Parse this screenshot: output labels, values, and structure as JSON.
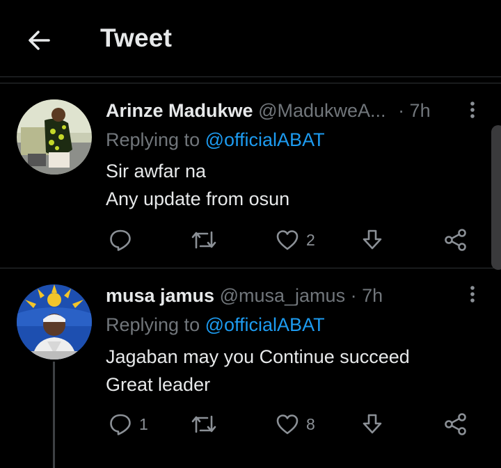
{
  "header": {
    "title": "Tweet"
  },
  "colors": {
    "background": "#000000",
    "link": "#1d9bf0",
    "secondary": "#71767b",
    "divider": "#2f3336"
  },
  "tweets": [
    {
      "name": "Arinze Madukwe",
      "handle": "@MadukweA...",
      "time": "· 7h",
      "replying_prefix": "Replying to ",
      "replying_handle": "@officialABAT",
      "lines": [
        "Sir awfar na",
        "Any update from osun"
      ],
      "reply_count": "",
      "retweet_count": "",
      "like_count": "2"
    },
    {
      "name": "musa jamus",
      "handle": "@musa_jamus",
      "time": "· 7h",
      "replying_prefix": "Replying to ",
      "replying_handle": "@officialABAT",
      "lines": [
        "Jagaban may you Continue succeed",
        "Great leader"
      ],
      "reply_count": "1",
      "retweet_count": "",
      "like_count": "8"
    }
  ],
  "icons": {
    "back": "arrow-left-icon",
    "more": "more-vertical-icon",
    "reply": "reply-icon",
    "retweet": "retweet-icon",
    "like": "heart-icon",
    "download": "download-icon",
    "share": "share-icon"
  }
}
